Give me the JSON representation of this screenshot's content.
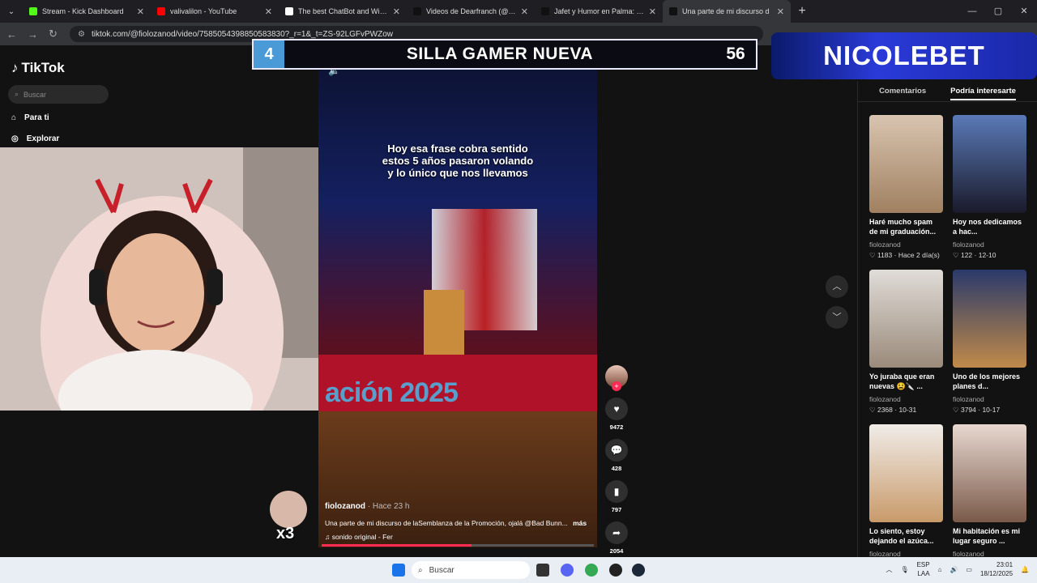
{
  "browser": {
    "tabs": [
      {
        "label": "Stream - Kick Dashboard",
        "color": "#53fc18",
        "active": false
      },
      {
        "label": "valivalilon - YouTube",
        "color": "#ff0000",
        "active": false
      },
      {
        "label": "The best ChatBot and Widgets",
        "color": "#ffffff",
        "active": false
      },
      {
        "label": "Videos de Dearfranch (@missde",
        "color": "#111111",
        "active": false
      },
      {
        "label": "Jafet y Humor en Palma: Meme",
        "color": "#111111",
        "active": false
      },
      {
        "label": "Una parte de mi discurso d",
        "color": "#111111",
        "active": true
      }
    ],
    "url": "tiktok.com/@fiolozanod/video/7585054398850583830?_r=1&_t=ZS-92LGFvPWZow"
  },
  "tiktok": {
    "logo": "TikTok",
    "search_placeholder": "Buscar",
    "nav": [
      {
        "label": "Para ti",
        "icon": "home-icon"
      },
      {
        "label": "Explorar",
        "icon": "compass-icon"
      }
    ]
  },
  "video": {
    "overlay_caption_1": "Hoy esa frase cobra sentido",
    "overlay_caption_2": "estos 5 años pasaron volando",
    "overlay_caption_3": "y lo único que nos llevamos",
    "stage_text": "ación 2025",
    "author": "fiolozanod",
    "time": "· Hace 23 h",
    "description": "Una parte de mi discurso de laSemblanza de la Promoción, ojalá @Bad Bunn...",
    "more": "más",
    "sound": "♫  sonido original - Fer",
    "progress": 0.55,
    "likes": "9472",
    "comments": "428",
    "saves": "797",
    "shares": "2054"
  },
  "right_panel": {
    "tab_comments": "Comentarios",
    "tab_interest": "Podría interesarte",
    "cards": [
      {
        "title": "Haré mucho spam de mi graduación...",
        "user": "fiolozanod",
        "stats": "♡ 1183 · Hace 2 día(s)",
        "color1": "#d8c4b0",
        "color2": "#a08060"
      },
      {
        "title": "Hoy nos dedicamos a hac...",
        "user": "fiolozanod",
        "stats": "♡ 122 · 12-10",
        "color1": "#5a7ab8",
        "color2": "#1a1a2a"
      },
      {
        "title": "Yo juraba que eran nuevas 😫🔪 ...",
        "user": "fiolozanod",
        "stats": "♡ 2368 · 10-31",
        "color1": "#e0dcd8",
        "color2": "#9a8a7a"
      },
      {
        "title": "Uno de los mejores planes d...",
        "user": "fiolozanod",
        "stats": "♡ 3794 · 10-17",
        "color1": "#2a3a6a",
        "color2": "#c08a4a"
      },
      {
        "title": "Lo siento, estoy dejando el azúca...",
        "user": "fiolozanod",
        "stats": "",
        "color1": "#f0ece8",
        "color2": "#c89a6a"
      },
      {
        "title": "Mi habitación es mi lugar seguro ...",
        "user": "fiolozanod",
        "stats": "",
        "color1": "#e8d8d0",
        "color2": "#7a5a4a"
      }
    ]
  },
  "stream_overlay": {
    "goal_number": "4",
    "goal_title": "SILLA GAMER NUEVA",
    "goal_count": "56",
    "sponsor": "NICOLEBET",
    "emote_multiplier": "x3"
  },
  "taskbar": {
    "search": "Buscar",
    "lang": "ESP",
    "lang2": "LAA",
    "time": "23:01",
    "date": "18/12/2025"
  }
}
